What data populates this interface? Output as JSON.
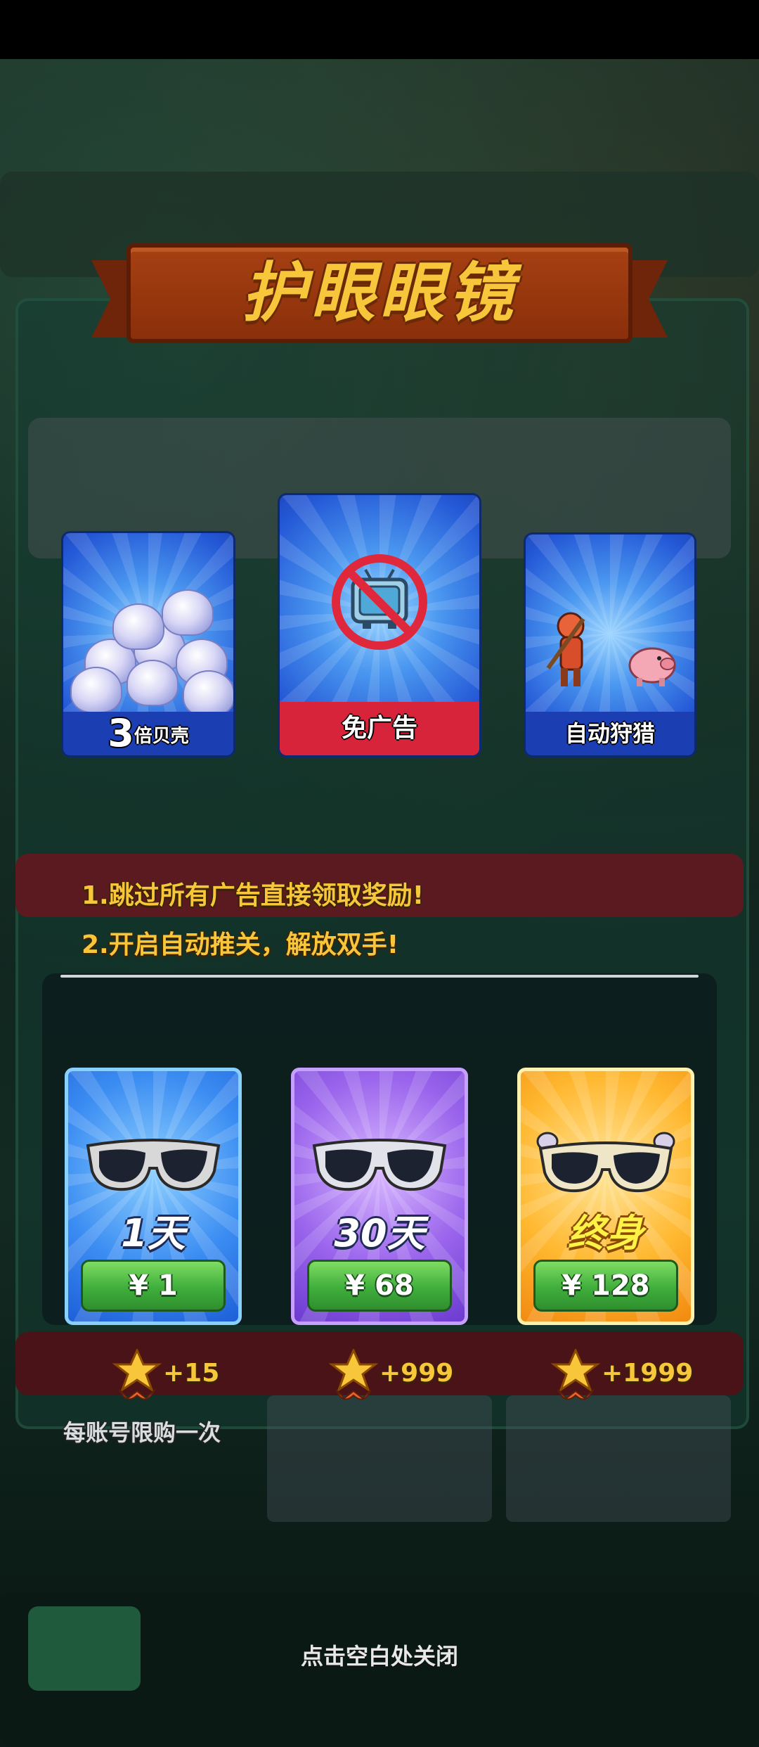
{
  "title": "护眼眼镜",
  "features": [
    {
      "big": "3",
      "small": "倍贝壳"
    },
    {
      "label": "免广告"
    },
    {
      "label": "自动狩猎"
    }
  ],
  "benefits": [
    "1.跳过所有广告直接领取奖励!",
    "2.开启自动推关，解放双手!"
  ],
  "packages": [
    {
      "duration": "1天",
      "price": "¥ 1",
      "bonus": "+15",
      "note": "每账号限购一次"
    },
    {
      "duration": "30天",
      "price": "¥ 68",
      "bonus": "+999"
    },
    {
      "duration": "终身",
      "price": "¥ 128",
      "bonus": "+1999"
    }
  ],
  "close_hint": "点击空白处关闭",
  "colors": {
    "gold": "#f7c63a",
    "banner": "#a64012",
    "buy_green": "#3fae3c",
    "noad_red": "#d8243a"
  }
}
